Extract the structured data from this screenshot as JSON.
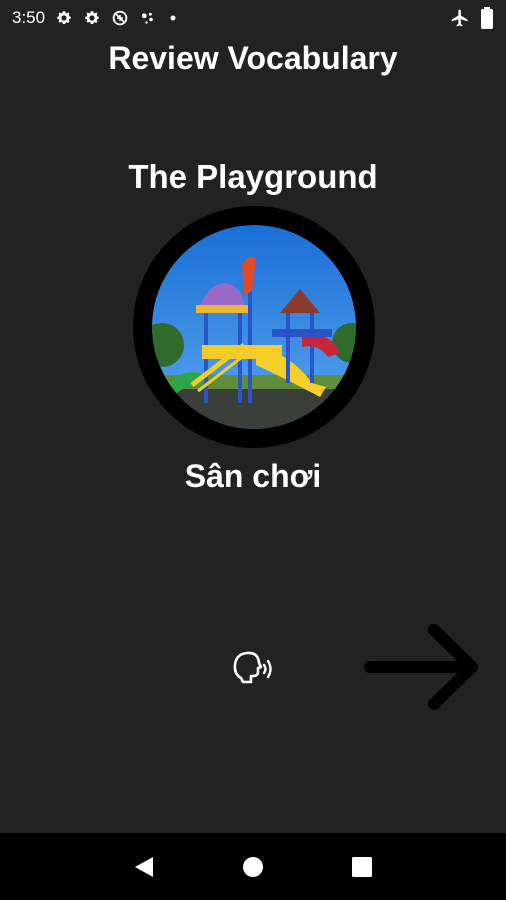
{
  "status_bar": {
    "time": "3:50",
    "left_icons": [
      "gear-icon",
      "gear-icon",
      "data-saver-icon",
      "assistant-dots-icon",
      "dot-icon"
    ],
    "right_icons": [
      "airplane-icon",
      "battery-icon"
    ]
  },
  "header": {
    "title": "Review Vocabulary"
  },
  "card": {
    "word": "The Playground",
    "image": "playground-image",
    "translation": "Sân chơi"
  },
  "actions": {
    "speak_icon": "speak-icon",
    "next_icon": "arrow-right-icon"
  },
  "nav_bar": {
    "buttons": [
      "back-icon",
      "home-icon",
      "recents-icon"
    ]
  },
  "colors": {
    "background": "#222222",
    "text": "#ffffff",
    "ring": "#000000",
    "nav_bar": "#000000"
  }
}
